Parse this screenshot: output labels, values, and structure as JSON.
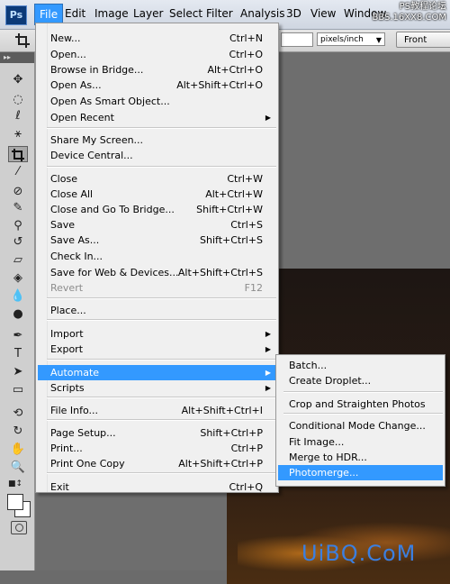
{
  "menubar": {
    "logo": "Ps",
    "items": [
      "File",
      "Edit",
      "Image",
      "Layer",
      "Select",
      "Filter",
      "Analysis",
      "3D",
      "View",
      "Window"
    ],
    "active_index": 0,
    "watermark": "PS教程论坛\nBBS.16XX8.COM"
  },
  "options": {
    "unit": "pixels/inch",
    "front_image_button": "Front Image"
  },
  "panel": {
    "header": "▸▸"
  },
  "file_menu": {
    "items": [
      {
        "label": "New...",
        "shortcut": "Ctrl+N"
      },
      {
        "label": "Open...",
        "shortcut": "Ctrl+O"
      },
      {
        "label": "Browse in Bridge...",
        "shortcut": "Alt+Ctrl+O"
      },
      {
        "label": "Open As...",
        "shortcut": "Alt+Shift+Ctrl+O"
      },
      {
        "label": "Open As Smart Object...",
        "shortcut": ""
      },
      {
        "label": "Open Recent",
        "shortcut": "",
        "submenu": true
      },
      {
        "label": "Share My Screen...",
        "shortcut": ""
      },
      {
        "label": "Device Central...",
        "shortcut": ""
      },
      {
        "label": "Close",
        "shortcut": "Ctrl+W"
      },
      {
        "label": "Close All",
        "shortcut": "Alt+Ctrl+W"
      },
      {
        "label": "Close and Go To Bridge...",
        "shortcut": "Shift+Ctrl+W"
      },
      {
        "label": "Save",
        "shortcut": "Ctrl+S"
      },
      {
        "label": "Save As...",
        "shortcut": "Shift+Ctrl+S"
      },
      {
        "label": "Check In...",
        "shortcut": ""
      },
      {
        "label": "Save for Web & Devices...",
        "shortcut": "Alt+Shift+Ctrl+S"
      },
      {
        "label": "Revert",
        "shortcut": "F12",
        "disabled": true
      },
      {
        "label": "Place...",
        "shortcut": ""
      },
      {
        "label": "Import",
        "shortcut": "",
        "submenu": true
      },
      {
        "label": "Export",
        "shortcut": "",
        "submenu": true
      },
      {
        "label": "Automate",
        "shortcut": "",
        "submenu": true,
        "highlighted": true
      },
      {
        "label": "Scripts",
        "shortcut": "",
        "submenu": true
      },
      {
        "label": "File Info...",
        "shortcut": "Alt+Shift+Ctrl+I"
      },
      {
        "label": "Page Setup...",
        "shortcut": "Shift+Ctrl+P"
      },
      {
        "label": "Print...",
        "shortcut": "Ctrl+P"
      },
      {
        "label": "Print One Copy",
        "shortcut": "Alt+Shift+Ctrl+P"
      },
      {
        "label": "Exit",
        "shortcut": "Ctrl+Q"
      }
    ]
  },
  "automate_menu": {
    "items": [
      {
        "label": "Batch..."
      },
      {
        "label": "Create Droplet..."
      },
      {
        "label": "Crop and Straighten Photos"
      },
      {
        "label": "Conditional Mode Change..."
      },
      {
        "label": "Fit Image..."
      },
      {
        "label": "Merge to HDR..."
      },
      {
        "label": "Photomerge...",
        "highlighted": true
      }
    ]
  },
  "watermark_bottom": "UiBQ.CoM",
  "colors": {
    "highlight": "#3399ff",
    "menu_bg": "#f0f0f0",
    "toolbar_bg": "#cfcfcf"
  }
}
